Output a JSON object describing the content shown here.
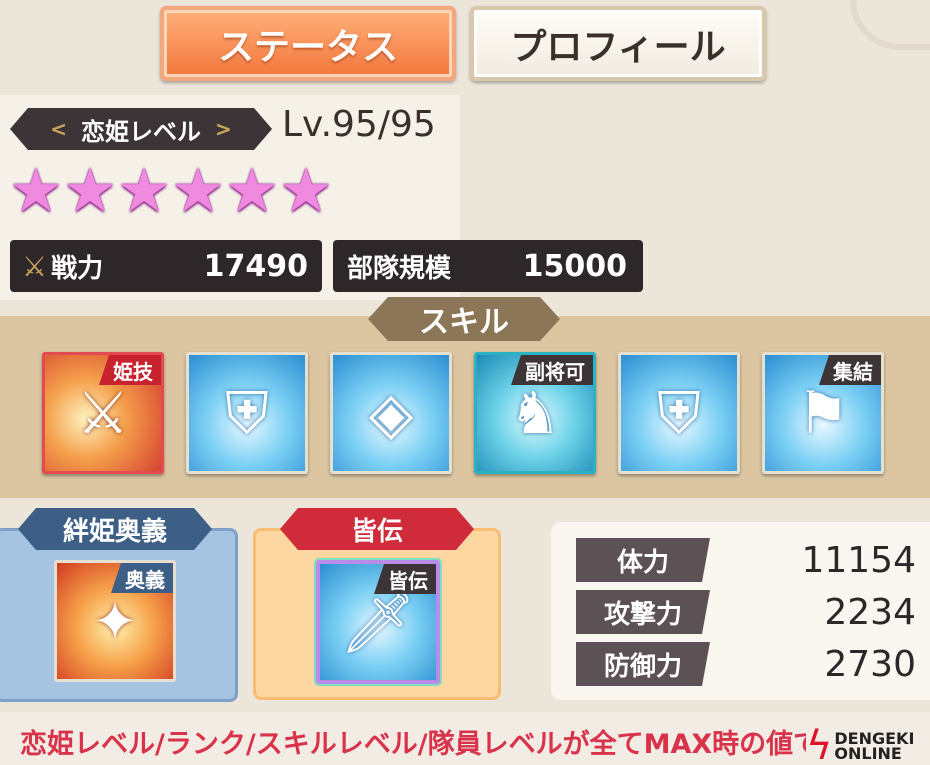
{
  "tabs": [
    {
      "label": "ステータス",
      "active": true
    },
    {
      "label": "プロフィール",
      "active": false
    }
  ],
  "level": {
    "label": "恋姫レベル",
    "chevron_left": "<",
    "chevron_right": ">",
    "value": "Lv.95/95"
  },
  "stars": {
    "count": 6,
    "glyph": "★",
    "color": "#f08ae0"
  },
  "power": {
    "icon": "crossed-swords-icon",
    "label": "戦力",
    "value": "17490"
  },
  "troop": {
    "label": "部隊規模",
    "value": "15000"
  },
  "skills": {
    "header": "スキル",
    "items": [
      {
        "icon": "sword-slash-icon",
        "tag": "姫技",
        "glyph": "⚔"
      },
      {
        "icon": "armor-icon",
        "tag": "",
        "glyph": "⛨"
      },
      {
        "icon": "shield-emblem-icon",
        "tag": "",
        "glyph": "◈"
      },
      {
        "icon": "soldier-icon",
        "tag": "副将可",
        "glyph": "♞"
      },
      {
        "icon": "triple-armor-icon",
        "tag": "",
        "glyph": "⛨"
      },
      {
        "icon": "banner-flag-icon",
        "tag": "集結",
        "glyph": "⚑"
      }
    ]
  },
  "kizuna": {
    "header": "絆姫奥義",
    "tag": "奥義",
    "icon": "group-attack-icon",
    "glyph": "✦"
  },
  "kaiden": {
    "header": "皆伝",
    "tag": "皆伝",
    "icon": "sword-icon",
    "glyph": "🗡"
  },
  "params": [
    {
      "label": "体力",
      "value": "11154"
    },
    {
      "label": "攻撃力",
      "value": "2234"
    },
    {
      "label": "防御力",
      "value": "2730"
    }
  ],
  "footer": {
    "note": "恋姫レベル/ランク/スキルレベル/隊員レベルが全てMAX時の値で"
  },
  "logo": {
    "line1": "DENGEKI",
    "line2": "ONLINE"
  },
  "colors": {
    "accent_tab": "#f2763c",
    "footer_text": "#d8334a",
    "kaiden_header": "#cf2b3a",
    "kizuna_header": "#3d5f86"
  }
}
